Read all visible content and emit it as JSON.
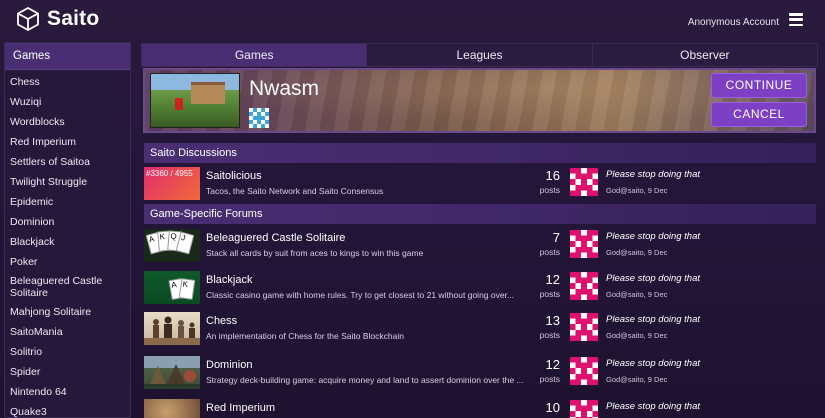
{
  "header": {
    "logo_text": "Saito",
    "account_label": "Anonymous Account"
  },
  "sidebar": {
    "title": "Games",
    "items": [
      "Chess",
      "Wuziqi",
      "Wordblocks",
      "Red Imperium",
      "Settlers of Saitoa",
      "Twilight Struggle",
      "Epidemic",
      "Dominion",
      "Blackjack",
      "Poker",
      "Beleaguered Castle Solitaire",
      "Mahjong Solitaire",
      "SaitoMania",
      "Solitrio",
      "Spider",
      "Nintendo 64",
      "Quake3"
    ]
  },
  "tabs": [
    {
      "label": "Games",
      "active": true
    },
    {
      "label": "Leagues",
      "active": false
    },
    {
      "label": "Observer",
      "active": false
    }
  ],
  "invite": {
    "title": "Nwasm",
    "continue_label": "CONTINUE",
    "cancel_label": "CANCEL"
  },
  "sections": [
    {
      "title": "Saito Discussions",
      "forums": [
        {
          "name": "Saitolicious",
          "desc": "Tacos, the Saito Network and Saito Consensus",
          "count": "16",
          "unit": "posts",
          "last": "Please stop doing that",
          "meta": "God@saito, 9 Dec",
          "thumb_text": "#3360 / 4955",
          "thumb": "pink"
        }
      ]
    },
    {
      "title": "Game-Specific Forums",
      "forums": [
        {
          "name": "Beleaguered Castle Solitaire",
          "desc": "Stack all cards by suit from aces to kings to win this game",
          "count": "7",
          "unit": "posts",
          "last": "Please stop doing that",
          "meta": "God@saito, 9 Dec",
          "thumb": "solitaire"
        },
        {
          "name": "Blackjack",
          "desc": "Classic casino game with home rules. Try to get closest to 21 without going over...",
          "count": "12",
          "unit": "posts",
          "last": "Please stop doing that",
          "meta": "God@saito, 9 Dec",
          "thumb": "blackjack"
        },
        {
          "name": "Chess",
          "desc": "An implementation of Chess for the Saito Blockchain",
          "count": "13",
          "unit": "posts",
          "last": "Please stop doing that",
          "meta": "God@saito, 9 Dec",
          "thumb": "chess"
        },
        {
          "name": "Dominion",
          "desc": "Strategy deck-building game: acquire money and land to assert dominion over the ...",
          "count": "12",
          "unit": "posts",
          "last": "Please stop doing that",
          "meta": "God@saito, 9 Dec",
          "thumb": "dominion"
        },
        {
          "name": "Red Imperium",
          "desc": "",
          "count": "10",
          "unit": "",
          "last": "Please stop doing that",
          "meta": "",
          "thumb": "imperium"
        }
      ]
    }
  ],
  "colors": {
    "accent": "#7d3fc4",
    "panel_header": "#4a2e74",
    "background": "#24163a",
    "identicon": "#e0106e"
  }
}
